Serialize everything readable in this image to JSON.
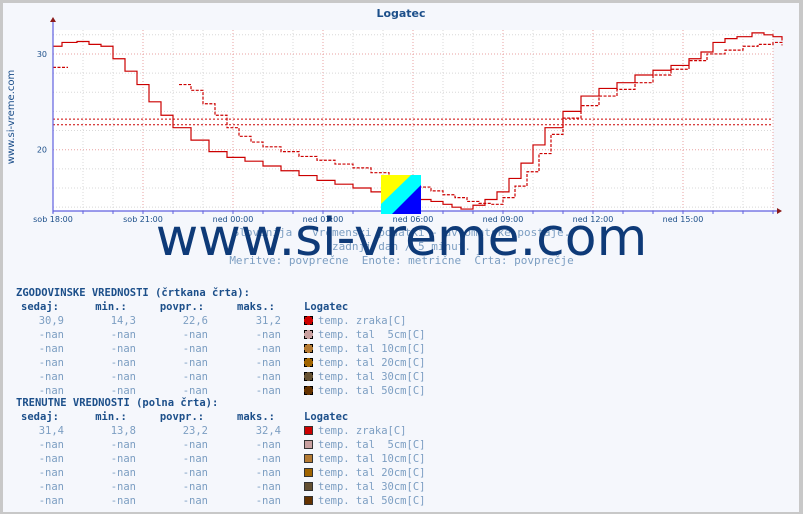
{
  "chart_data": {
    "type": "line",
    "title": "Logatec",
    "side_label": "www.si-vreme.com",
    "xlabel": "",
    "ylabel": "",
    "ylim": [
      13.6,
      32.5
    ],
    "yticks": [
      20,
      30
    ],
    "ytick_labels": [
      "20",
      "30"
    ],
    "xlim_hours": [
      0,
      24
    ],
    "xticks_hours": [
      0,
      3,
      6,
      9,
      12,
      15,
      18,
      21
    ],
    "xtick_labels": [
      "sob 18:00",
      "sob 21:00",
      "ned 00:00",
      "ned 03:00",
      "ned 06:00",
      "ned 09:00",
      "ned 12:00",
      "ned 15:00"
    ],
    "grid": true,
    "series": [
      {
        "name": "temp. zraka[C] (trenutne)",
        "style": "solid",
        "color": "#cc0000",
        "x": [
          0,
          0.3,
          0.8,
          1.2,
          1.6,
          2.0,
          2.4,
          2.8,
          3.2,
          3.6,
          4.0,
          4.6,
          5.2,
          5.8,
          6.4,
          7.0,
          7.6,
          8.2,
          8.8,
          9.4,
          10.0,
          10.6,
          11.2,
          11.8,
          12.2,
          12.6,
          13.0,
          13.3,
          13.6,
          14.0,
          14.4,
          14.8,
          15.2,
          15.6,
          16.0,
          16.4,
          17.0,
          17.6,
          18.2,
          18.8,
          19.4,
          20.0,
          20.6,
          21.2,
          21.6,
          22.0,
          22.4,
          22.8,
          23.3,
          23.7,
          24.0,
          24.3
        ],
        "y": [
          30.8,
          31.2,
          31.3,
          31.0,
          30.8,
          29.5,
          28.2,
          26.8,
          25.0,
          23.6,
          22.3,
          21.0,
          19.8,
          19.2,
          18.8,
          18.3,
          17.8,
          17.3,
          16.8,
          16.4,
          16.0,
          15.6,
          15.2,
          15.0,
          14.8,
          14.6,
          14.3,
          14.0,
          13.8,
          14.2,
          14.8,
          15.6,
          17.0,
          18.6,
          20.5,
          22.3,
          24.0,
          25.6,
          26.4,
          27.0,
          27.8,
          28.3,
          28.8,
          29.5,
          30.2,
          31.2,
          31.6,
          31.8,
          32.2,
          32.0,
          31.8,
          31.4
        ]
      },
      {
        "name": "temp. zraka[C] (zgodovinske)",
        "style": "dashed",
        "color": "#cc0000",
        "x": [
          4.2,
          4.6,
          5.0,
          5.4,
          5.8,
          6.2,
          6.6,
          7.0,
          7.6,
          8.2,
          8.8,
          9.4,
          10.0,
          10.6,
          11.2,
          11.8,
          12.2,
          12.6,
          13.0,
          13.4,
          13.8,
          14.2,
          14.6,
          15.0,
          15.4,
          15.8,
          16.2,
          16.6,
          17.0,
          17.6,
          18.2,
          18.8,
          19.4,
          20.0,
          20.6,
          21.2,
          21.8,
          22.4,
          23.0,
          23.5,
          24.0,
          24.3
        ],
        "y": [
          26.8,
          26.2,
          24.8,
          23.6,
          22.3,
          21.4,
          20.8,
          20.3,
          19.8,
          19.3,
          18.9,
          18.5,
          18.1,
          17.6,
          17.1,
          16.5,
          16.1,
          15.7,
          15.3,
          15.0,
          14.6,
          14.4,
          14.3,
          15.0,
          16.2,
          17.7,
          19.6,
          21.6,
          23.3,
          24.6,
          25.6,
          26.3,
          27.0,
          27.8,
          28.4,
          29.3,
          30.0,
          30.4,
          30.8,
          31.0,
          31.2,
          30.9
        ]
      },
      {
        "name": "temp. zraka[C] (zgodovinske, zacetek)",
        "style": "dashed",
        "color": "#cc0000",
        "x": [
          0,
          0.5
        ],
        "y": [
          28.6,
          28.6
        ]
      }
    ],
    "reference_lines": [
      {
        "name": "povprecje trenutne",
        "y": 23.2,
        "style": "dotted",
        "color": "#cc0000"
      },
      {
        "name": "povprecje zgodovinske",
        "y": 22.6,
        "style": "dotted",
        "color": "#cc0000"
      }
    ]
  },
  "subtitle": {
    "line1": "Slovenija / vremenski podatki - avtomatske postaje.",
    "line2": "zadnji dan / 5 minut.",
    "line3": "Meritve: povprečne  Enote: metrične  Črta: povprečje"
  },
  "watermark": "www.si-vreme.com",
  "tables": [
    {
      "heading": "ZGODOVINSKE VREDNOSTI (črtkana črta):",
      "headers": [
        "sedaj:",
        "min.:",
        "povpr.:",
        "maks.:"
      ],
      "station": "Logatec",
      "swatch_style": "dash",
      "rows": [
        {
          "values": [
            "30,9",
            "14,3",
            "22,6",
            "31,2"
          ],
          "label": "temp. zraka[C]",
          "color": "#cc0000"
        },
        {
          "values": [
            "-nan",
            "-nan",
            "-nan",
            "-nan"
          ],
          "label": "temp. tal  5cm[C]",
          "color": "#c8a0a0"
        },
        {
          "values": [
            "-nan",
            "-nan",
            "-nan",
            "-nan"
          ],
          "label": "temp. tal 10cm[C]",
          "color": "#b47a32"
        },
        {
          "values": [
            "-nan",
            "-nan",
            "-nan",
            "-nan"
          ],
          "label": "temp. tal 20cm[C]",
          "color": "#a06400"
        },
        {
          "values": [
            "-nan",
            "-nan",
            "-nan",
            "-nan"
          ],
          "label": "temp. tal 30cm[C]",
          "color": "#645032"
        },
        {
          "values": [
            "-nan",
            "-nan",
            "-nan",
            "-nan"
          ],
          "label": "temp. tal 50cm[C]",
          "color": "#643200"
        }
      ]
    },
    {
      "heading": "TRENUTNE VREDNOSTI (polna črta):",
      "headers": [
        "sedaj:",
        "min.:",
        "povpr.:",
        "maks.:"
      ],
      "station": "Logatec",
      "swatch_style": "solid",
      "rows": [
        {
          "values": [
            "31,4",
            "13,8",
            "23,2",
            "32,4"
          ],
          "label": "temp. zraka[C]",
          "color": "#cc0000"
        },
        {
          "values": [
            "-nan",
            "-nan",
            "-nan",
            "-nan"
          ],
          "label": "temp. tal  5cm[C]",
          "color": "#c8a0a0"
        },
        {
          "values": [
            "-nan",
            "-nan",
            "-nan",
            "-nan"
          ],
          "label": "temp. tal 10cm[C]",
          "color": "#b47a32"
        },
        {
          "values": [
            "-nan",
            "-nan",
            "-nan",
            "-nan"
          ],
          "label": "temp. tal 20cm[C]",
          "color": "#a06400"
        },
        {
          "values": [
            "-nan",
            "-nan",
            "-nan",
            "-nan"
          ],
          "label": "temp. tal 30cm[C]",
          "color": "#645032"
        },
        {
          "values": [
            "-nan",
            "-nan",
            "-nan",
            "-nan"
          ],
          "label": "temp. tal 50cm[C]",
          "color": "#643200"
        }
      ]
    }
  ]
}
